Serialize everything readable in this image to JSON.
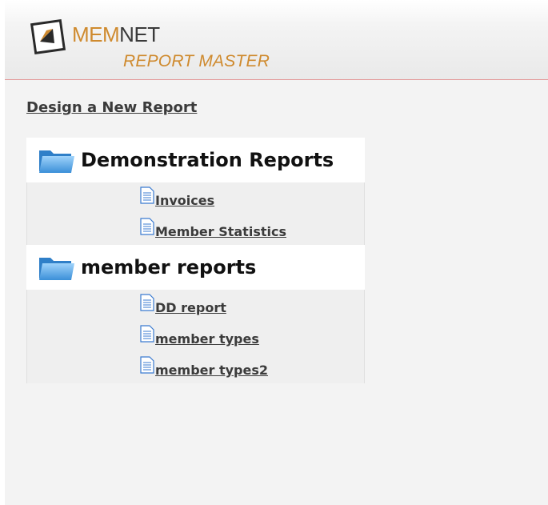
{
  "header": {
    "logo_mem": "MEM",
    "logo_net": "NET",
    "logo_subtitle": "REPORT MASTER"
  },
  "actions": {
    "design_new_report": "Design a New Report"
  },
  "folders": [
    {
      "label": "Demonstration Reports",
      "items": [
        {
          "label": "Invoices"
        },
        {
          "label": "Member Statistics"
        }
      ]
    },
    {
      "label": "member reports",
      "items": [
        {
          "label": "DD report"
        },
        {
          "label": "member types"
        },
        {
          "label": "member types2"
        }
      ]
    }
  ],
  "icons": {
    "logo": "memnet-logo-icon",
    "folder": "folder-icon",
    "report": "document-icon"
  },
  "colors": {
    "brand_orange": "#cf8a2e",
    "header_rule": "#e39a9a",
    "link_text": "#3b3b3b",
    "folder_blue": "#4a9fe0"
  }
}
